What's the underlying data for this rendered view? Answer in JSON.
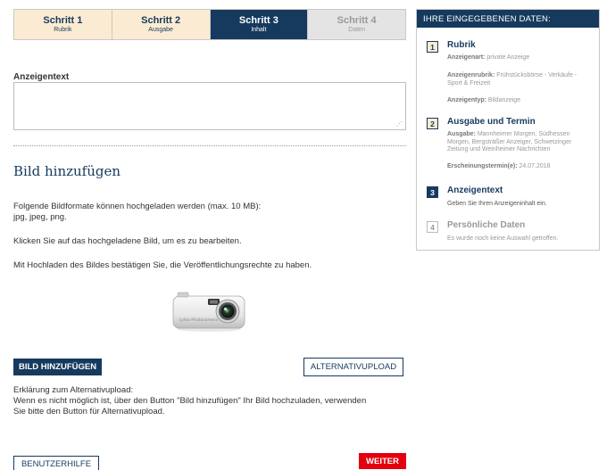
{
  "steps": [
    {
      "title": "Schritt 1",
      "sub": "Rubrik"
    },
    {
      "title": "Schritt 2",
      "sub": "Ausgabe"
    },
    {
      "title": "Schritt 3",
      "sub": "Inhalt"
    },
    {
      "title": "Schritt 4",
      "sub": "Daten"
    }
  ],
  "form": {
    "label": "Anzeigentext",
    "textarea_value": ""
  },
  "image_section": {
    "heading": "Bild hinzufügen",
    "formats_line1": "Folgende Bildformate können hochgeladen werden (max. 10 MB):",
    "formats_line2": "jpg, jpeg, png.",
    "click_hint": "Klicken Sie auf das hochgeladene Bild, um es zu bearbeiten.",
    "rights_hint": "Mit Hochladen des Bildes bestätigen Sie, die Veröffentlichungsrechte zu haben.",
    "camera_brand": "Lyfoo Photocamera",
    "add_button": "BILD HINZUFÜGEN",
    "alt_button": "ALTERNATIVUPLOAD",
    "alt_title": "Erklärung zum Alternativupload:",
    "alt_line1": "Wenn es nicht möglich ist, über den Button \"Bild hinzufügen\" Ihr Bild hochzuladen, verwenden",
    "alt_line2": "Sie bitte den Button für Alternativupload."
  },
  "footer": {
    "help_button": "BENUTZERHILFE",
    "next_button": "WEITER"
  },
  "sidebar": {
    "header": "IHRE EINGEGEBENEN DATEN:",
    "items": [
      {
        "num": "1",
        "title": "Rubrik",
        "lines": [
          {
            "key": "Anzeigenart:",
            "val": " private Anzeige"
          },
          {
            "key": "Anzeigenrubrik:",
            "val": " Frühstücksbörse - Verkäufe - Sport & Freizeit"
          },
          {
            "key": "Anzeigentyp:",
            "val": " Bildanzeige"
          }
        ]
      },
      {
        "num": "2",
        "title": "Ausgabe und Termin",
        "lines": [
          {
            "key": "Ausgabe:",
            "val": " Mannheimer Morgen, Südhessen Morgen, Bergsträßer Anzeiger, Schwetzinger Zeitung und Weinheimer Nachrichten"
          },
          {
            "key": "Erscheinungstermin(e):",
            "val": " 24.07.2018"
          }
        ]
      },
      {
        "num": "3",
        "title": "Anzeigentext",
        "desc": "Geben Sie Ihren Anzeigeninhalt ein."
      },
      {
        "num": "4",
        "title": "Persönliche Daten",
        "desc": "Es wurde noch keine Auswahl getroffen."
      }
    ]
  },
  "colors": {
    "navy": "#163a5e",
    "done": "#fcebd3",
    "todo": "#e4e4e4",
    "red": "#e3000f"
  }
}
